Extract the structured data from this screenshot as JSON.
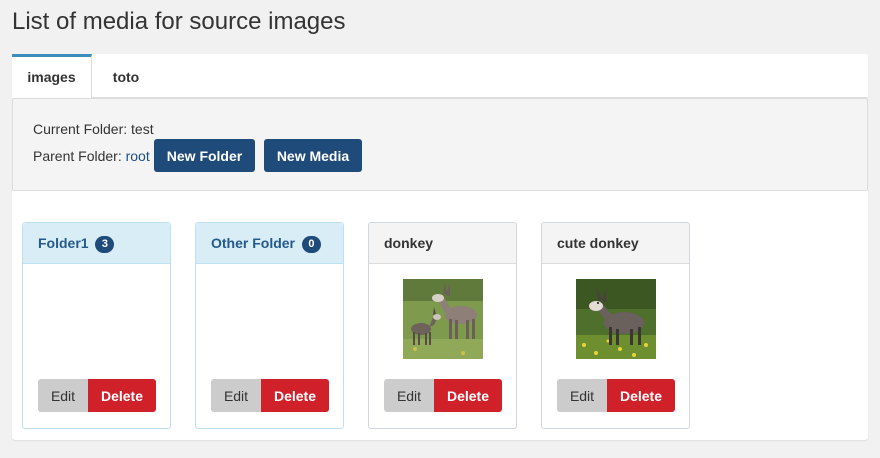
{
  "page": {
    "title": "List of media for source images"
  },
  "tabs": [
    {
      "label": "images",
      "active": true
    },
    {
      "label": "toto",
      "active": false
    }
  ],
  "toolbar": {
    "current_folder_label": "Current Folder: test",
    "parent_folder_label": "Parent Folder: ",
    "parent_folder_link": "root",
    "new_folder_label": "New Folder",
    "new_media_label": "New Media"
  },
  "items": [
    {
      "type": "folder",
      "name": "Folder1",
      "count": "3",
      "edit_label": "Edit",
      "delete_label": "Delete"
    },
    {
      "type": "folder",
      "name": "Other Folder",
      "count": "0",
      "edit_label": "Edit",
      "delete_label": "Delete"
    },
    {
      "type": "media",
      "name": "donkey",
      "image": "donkey-photo",
      "edit_label": "Edit",
      "delete_label": "Delete"
    },
    {
      "type": "media",
      "name": "cute donkey",
      "image": "cute-donkey-photo",
      "edit_label": "Edit",
      "delete_label": "Delete"
    }
  ],
  "colors": {
    "primary": "#1f4b7a",
    "danger": "#d0202a",
    "tab_accent": "#3c8dbc",
    "folder_header": "#d9edf7"
  }
}
